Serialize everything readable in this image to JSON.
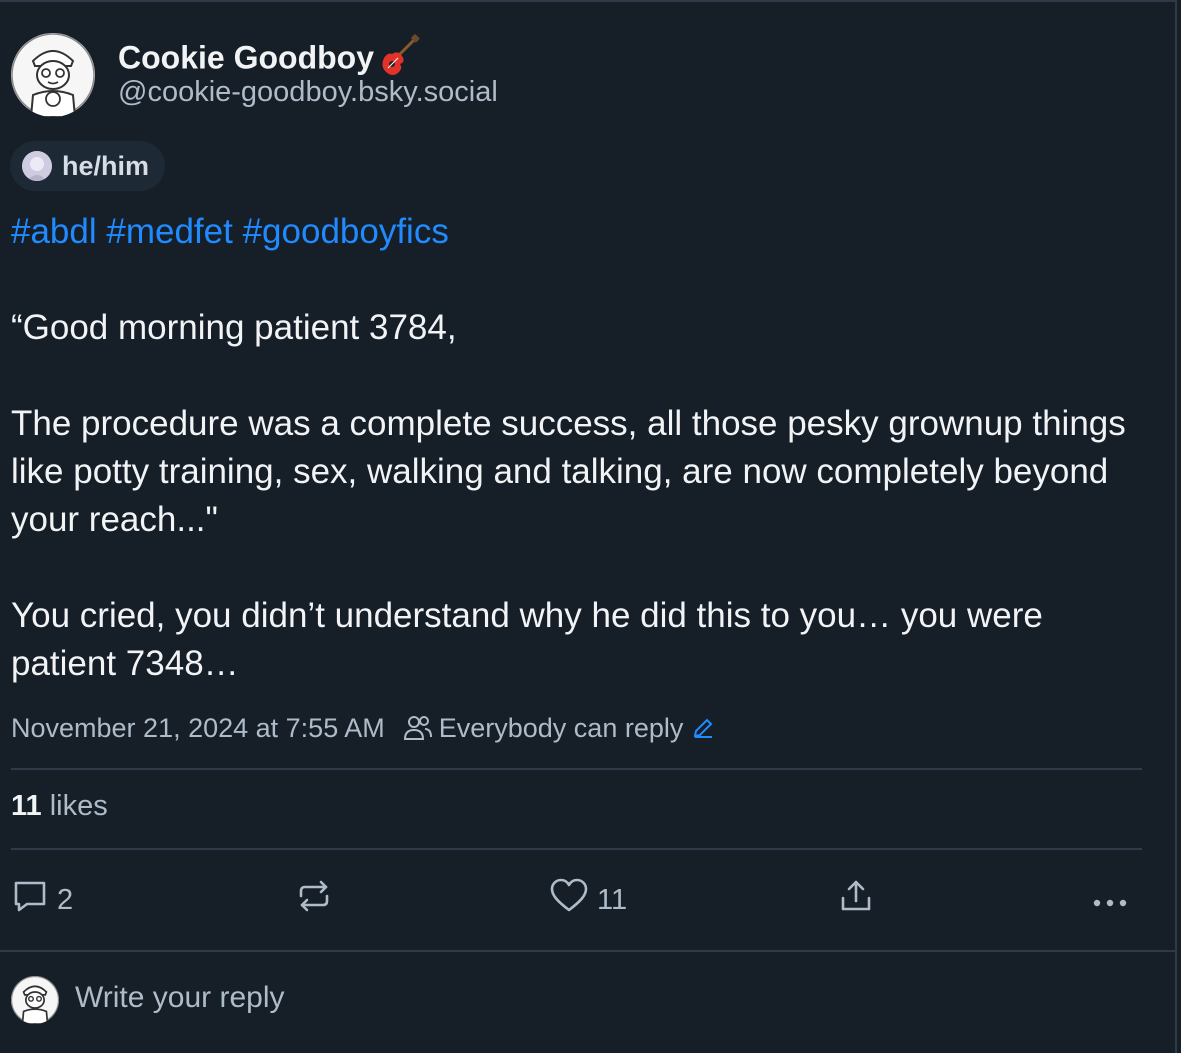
{
  "author": {
    "display_name": "Cookie Goodboy",
    "name_emoji": "guitar-emoji",
    "handle": "@cookie-goodboy.bsky.social",
    "pronouns": "he/him"
  },
  "post": {
    "hashtags": [
      "#abdl",
      "#medfet",
      "#goodboyfics"
    ],
    "paragraph_1": "“Good morning patient 3784,",
    "paragraph_2": "The procedure was a complete success, all those pesky grownup things like potty training, sex, walking and talking, are now completely beyond your reach...\"",
    "paragraph_3": "You cried, you didn’t understand why he did this to you… you were patient 7348…",
    "timestamp": "November 21, 2024 at 7:55 AM",
    "reply_setting": "Everybody can reply"
  },
  "stats": {
    "likes_count": "11",
    "likes_label": " likes"
  },
  "actions": {
    "reply_count": "2",
    "like_count": "11",
    "icons": [
      "reply-icon",
      "repost-icon",
      "heart-icon",
      "share-icon",
      "more-icon"
    ]
  },
  "reply_box": {
    "placeholder": "Write your reply"
  },
  "colors": {
    "background": "#161e27",
    "text": "#f1f3f5",
    "muted": "#aebbc9",
    "link": "#208bfe",
    "divider": "#2e3a48"
  }
}
